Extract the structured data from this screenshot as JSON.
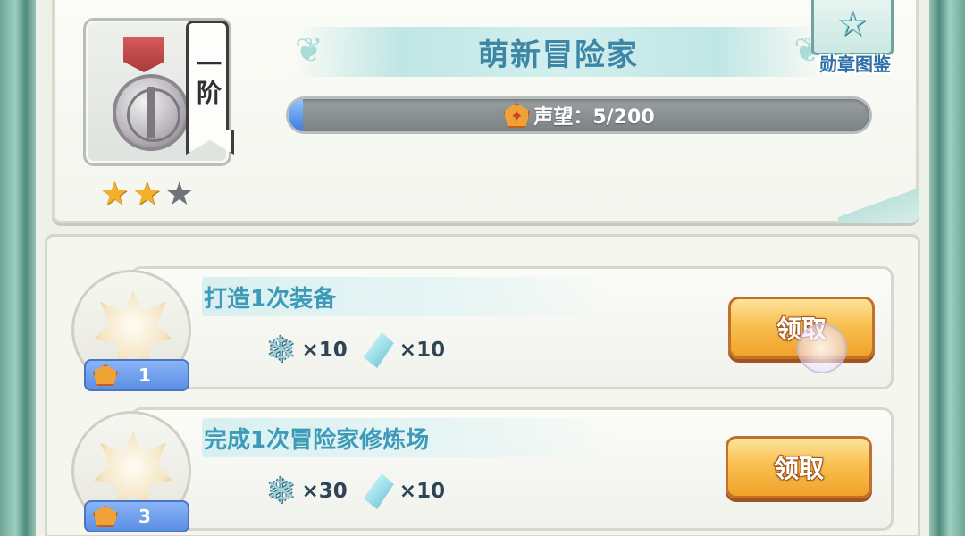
{
  "header": {
    "rank_label": "一阶",
    "stars_filled": 2,
    "stars_total": 3,
    "title": "萌新冒险家",
    "reputation": {
      "label": "声望：5/200",
      "current": 5,
      "max": 200
    },
    "catalog_label": "勋章图鉴"
  },
  "icons": {
    "medal": "medal-icon",
    "star": "star-icon",
    "reputation": "reputation-gem-icon",
    "catalog": "star-book-icon",
    "task": "sparkle-star-icon",
    "reward_1": "snowflake-crystal-icon",
    "reward_2": "blue-crystal-icon"
  },
  "tasks": [
    {
      "title": "打造1次装备",
      "reputation": "1",
      "rewards": [
        {
          "icon": "snowflake-crystal-icon",
          "amount": "×10"
        },
        {
          "icon": "blue-crystal-icon",
          "amount": "×10"
        }
      ],
      "button": "领取"
    },
    {
      "title": "完成1次冒险家修炼场",
      "reputation": "3",
      "rewards": [
        {
          "icon": "snowflake-crystal-icon",
          "amount": "×30"
        },
        {
          "icon": "blue-crystal-icon",
          "amount": "×10"
        }
      ],
      "button": "领取"
    }
  ],
  "colors": {
    "title": "#3e86a6",
    "task_title": "#3d9ab8",
    "button": "#f8c050",
    "progress_fill": "#3d79e0"
  }
}
